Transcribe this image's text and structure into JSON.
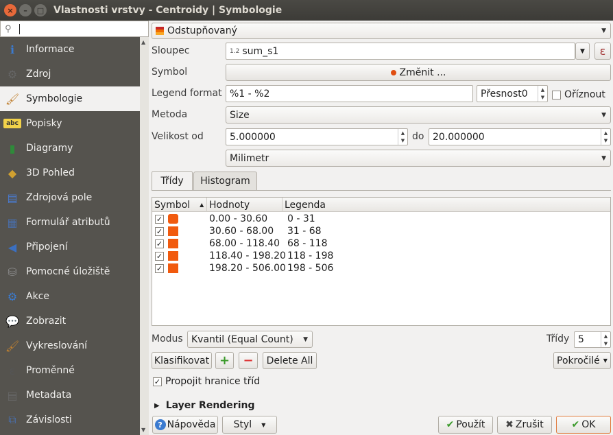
{
  "window": {
    "title": "Vlastnosti vrstvy - Centroidy | Symbologie",
    "close": "×",
    "minimize": "–",
    "maximize": "□"
  },
  "sidebar": {
    "search_placeholder": "",
    "items": [
      {
        "label": "Informace",
        "icon": "info-icon",
        "glyph": "ℹ"
      },
      {
        "label": "Zdroj",
        "icon": "source-icon",
        "glyph": "⚙"
      },
      {
        "label": "Symbologie",
        "icon": "symbology-brush-icon",
        "glyph": "🖌"
      },
      {
        "label": "Popisky",
        "icon": "labels-abc-icon",
        "glyph": "abc"
      },
      {
        "label": "Diagramy",
        "icon": "diagrams-icon",
        "glyph": "▮"
      },
      {
        "label": "3D Pohled",
        "icon": "3d-cube-icon",
        "glyph": "◆"
      },
      {
        "label": "Zdrojová pole",
        "icon": "fields-icon",
        "glyph": "▤"
      },
      {
        "label": "Formulář atributů",
        "icon": "form-icon",
        "glyph": "▦"
      },
      {
        "label": "Připojení",
        "icon": "join-icon",
        "glyph": "◀"
      },
      {
        "label": "Pomocné úložiště",
        "icon": "storage-icon",
        "glyph": "⛁"
      },
      {
        "label": "Akce",
        "icon": "actions-icon",
        "glyph": "⚙"
      },
      {
        "label": "Zobrazit",
        "icon": "display-tooltip-icon",
        "glyph": "💬"
      },
      {
        "label": "Vykreslování",
        "icon": "rendering-brush-icon",
        "glyph": "🖌"
      },
      {
        "label": "Proměnné",
        "icon": "variables-epsilon-icon",
        "glyph": "ε"
      },
      {
        "label": "Metadata",
        "icon": "metadata-icon",
        "glyph": "▤"
      },
      {
        "label": "Závislosti",
        "icon": "dependencies-icon",
        "glyph": "⧉"
      }
    ],
    "active_index": 2
  },
  "renderer": {
    "selected": "Odstupňovaný"
  },
  "form": {
    "column_label": "Sloupec",
    "column_type_prefix": "1.2",
    "column_value": "sum_s1",
    "expression_symbol": "ε",
    "symbol_label": "Symbol",
    "symbol_button": "Změnit ...",
    "legend_format_label": "Legend format",
    "legend_format_value": "%1 - %2",
    "precision_label": "Přesnost",
    "precision_value": "0",
    "trim_label": "Oříznout",
    "method_label": "Metoda",
    "method_value": "Size",
    "size_from_label": "Velikost od",
    "size_from_value": "5.000000",
    "size_to_label": "do",
    "size_to_value": "20.000000",
    "unit_value": "Milimetr"
  },
  "tabs": [
    {
      "label": "Třídy",
      "active": true
    },
    {
      "label": "Histogram",
      "active": false
    }
  ],
  "table": {
    "headers": [
      "Symbol",
      "Hodnoty",
      "Legenda"
    ],
    "rows": [
      {
        "checked": true,
        "values": "0.00 - 30.60",
        "legend": "0 - 31"
      },
      {
        "checked": true,
        "values": "30.60 - 68.00",
        "legend": "31 - 68"
      },
      {
        "checked": true,
        "values": "68.00 - 118.40",
        "legend": "68 - 118"
      },
      {
        "checked": true,
        "values": "118.40 - 198.20",
        "legend": "118 - 198"
      },
      {
        "checked": true,
        "values": "198.20 - 506.00",
        "legend": "198 - 506"
      }
    ],
    "swatch_color": "#f15a0e"
  },
  "mode": {
    "label": "Modus",
    "value": "Kvantil (Equal Count)",
    "classes_label": "Třídy",
    "classes_value": "5"
  },
  "actions": {
    "classify": "Klasifikovat",
    "add": "+",
    "remove": "−",
    "delete_all": "Delete All",
    "advanced": "Pokročilé",
    "link_label": "Propojit hranice tříd",
    "link_checked": true
  },
  "layer_rendering": "Layer Rendering",
  "footer": {
    "help": "Nápověda",
    "help_glyph": "?",
    "style": "Styl",
    "apply": "Použít",
    "cancel": "Zrušit",
    "ok": "OK"
  }
}
